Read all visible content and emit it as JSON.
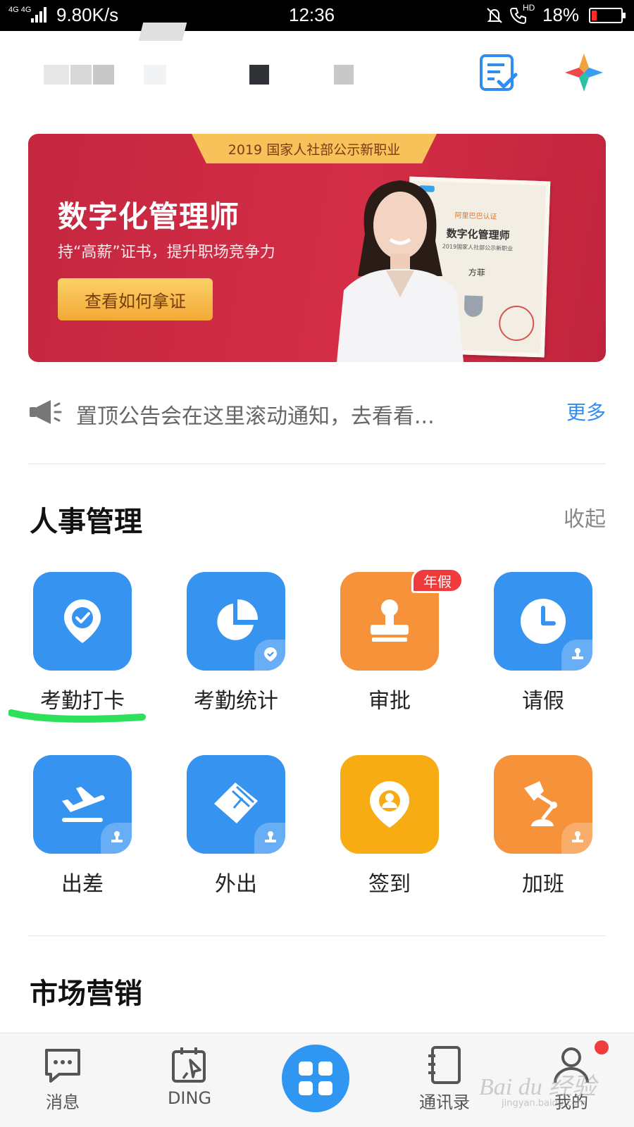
{
  "status_bar": {
    "network": "4G 4G",
    "speed": "9.80K/s",
    "time": "12:36",
    "hd": "HD",
    "battery": "18%",
    "battery_level": 0.18
  },
  "banner": {
    "ribbon": "2019 国家人社部公示新职业",
    "title": "数字化管理师",
    "subtitle": "持“高薪”证书，提升职场竞争力",
    "button": "查看如何拿证",
    "certificate": {
      "brand": "阿里巴巴认证",
      "title": "数字化管理师",
      "subtitle": "2019国家人社部公示新职业",
      "name": "方菲"
    }
  },
  "notice": {
    "text": "置顶公告会在这里滚动通知，去看看...",
    "more": "更多"
  },
  "hr_section": {
    "title": "人事管理",
    "action": "收起",
    "apps": [
      {
        "label": "考勤打卡",
        "icon": "location-check-icon",
        "color": "#3693f0"
      },
      {
        "label": "考勤统计",
        "icon": "pie-chart-icon",
        "color": "#3693f0"
      },
      {
        "label": "审批",
        "icon": "stamp-icon",
        "color": "#f6923a",
        "badge": "年假"
      },
      {
        "label": "请假",
        "icon": "clock-icon",
        "color": "#3693f0"
      },
      {
        "label": "出差",
        "icon": "airplane-icon",
        "color": "#3693f0"
      },
      {
        "label": "外出",
        "icon": "outing-icon",
        "color": "#3693f0"
      },
      {
        "label": "签到",
        "icon": "checkin-pin-icon",
        "color": "#f7ac14"
      },
      {
        "label": "加班",
        "icon": "desk-lamp-icon",
        "color": "#f6923a"
      }
    ]
  },
  "marketing_section": {
    "title": "市场营销"
  },
  "bottom_nav": {
    "items": [
      {
        "label": "消息",
        "icon": "chat-icon"
      },
      {
        "label": "DING",
        "icon": "ding-icon"
      },
      {
        "label": "",
        "icon": "workbench-icon"
      },
      {
        "label": "通讯录",
        "icon": "contacts-icon"
      },
      {
        "label": "我的",
        "icon": "profile-icon"
      }
    ],
    "watermark": "Bai du 经验",
    "watermark_url": "jingyan.baidu.com"
  }
}
